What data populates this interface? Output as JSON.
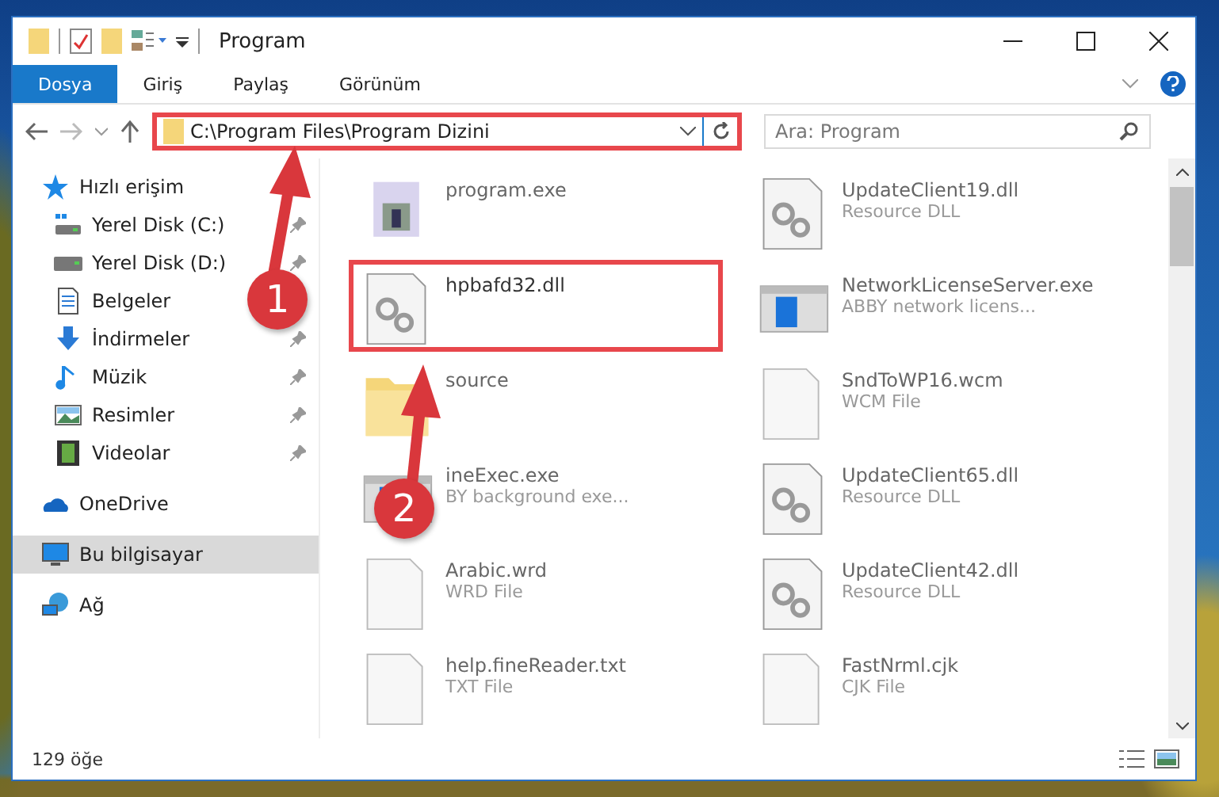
{
  "window": {
    "title": "Program"
  },
  "ribbon": {
    "tabs": [
      {
        "label": "Dosya",
        "selected": true
      },
      {
        "label": "Giriş",
        "selected": false
      },
      {
        "label": "Paylaş",
        "selected": false
      },
      {
        "label": "Görünüm",
        "selected": false
      }
    ]
  },
  "address": {
    "path": "C:\\Program Files\\Program Dizini",
    "outlined": true
  },
  "search": {
    "placeholder": "Ara: Program"
  },
  "sidebar": {
    "items": [
      {
        "label": "Hızlı erişim",
        "kind": "star",
        "pinned": false,
        "selected": false,
        "group": true
      },
      {
        "label": "Yerel Disk (C:)",
        "kind": "drive-c",
        "pinned": true,
        "selected": false,
        "group": false
      },
      {
        "label": "Yerel Disk (D:)",
        "kind": "drive",
        "pinned": true,
        "selected": false,
        "group": false
      },
      {
        "label": "Belgeler",
        "kind": "document",
        "pinned": false,
        "selected": false,
        "group": false
      },
      {
        "label": "İndirmeler",
        "kind": "download",
        "pinned": true,
        "selected": false,
        "group": false
      },
      {
        "label": "Müzik",
        "kind": "music",
        "pinned": true,
        "selected": false,
        "group": false
      },
      {
        "label": "Resimler",
        "kind": "pictures",
        "pinned": true,
        "selected": false,
        "group": false
      },
      {
        "label": "Videolar",
        "kind": "videos",
        "pinned": true,
        "selected": false,
        "group": false
      },
      {
        "label": "OneDrive",
        "kind": "cloud",
        "pinned": false,
        "selected": false,
        "group": true
      },
      {
        "label": "Bu bilgisayar",
        "kind": "computer",
        "pinned": false,
        "selected": true,
        "group": true
      },
      {
        "label": "Ağ",
        "kind": "network",
        "pinned": false,
        "selected": false,
        "group": true
      }
    ]
  },
  "files": [
    {
      "name": "program.exe",
      "kind": "app",
      "outlined": false
    },
    {
      "name": "UpdateClient19.dll",
      "description": "Resource DLL",
      "kind": "dll",
      "outlined": false
    },
    {
      "name": "hpbafd32.dll",
      "kind": "dll",
      "outlined": true
    },
    {
      "name": "NetworkLicenseServer.exe",
      "description": "ABBY network licens...",
      "kind": "window",
      "outlined": false
    },
    {
      "name": "source",
      "kind": "folder",
      "outlined": false
    },
    {
      "name": "SndToWP16.wcm",
      "description": "WCM File",
      "kind": "doc",
      "outlined": false
    },
    {
      "name": "ineExec.exe",
      "description": "BY background exe...",
      "kind": "window",
      "outlined": false
    },
    {
      "name": "UpdateClient65.dll",
      "description": "Resource DLL",
      "kind": "dll",
      "outlined": false
    },
    {
      "name": "Arabic.wrd",
      "description": "WRD File",
      "kind": "doc",
      "outlined": false
    },
    {
      "name": "UpdateClient42.dll",
      "description": "Resource DLL",
      "kind": "dll",
      "outlined": false
    },
    {
      "name": "help.fineReader.txt",
      "description": "TXT File",
      "kind": "doc",
      "outlined": false
    },
    {
      "name": "FastNrml.cjk",
      "description": "CJK File",
      "kind": "doc",
      "outlined": false
    }
  ],
  "status_bar": {
    "count": "129 öğe"
  },
  "callouts": [
    {
      "number": "1"
    },
    {
      "number": "2"
    }
  ]
}
